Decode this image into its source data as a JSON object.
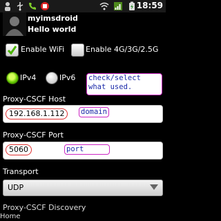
{
  "status_bar": {
    "time": "18:59",
    "icons": [
      "person-icon",
      "usb-icon",
      "call-icon",
      "stop-icon",
      "wifi-icon",
      "signal-icon",
      "battery-icon"
    ]
  },
  "header": {
    "name": "myimsdroid",
    "subtitle": "Hello world"
  },
  "checkboxes": [
    {
      "label": "Enable WiFi",
      "checked": true
    },
    {
      "label": "Enable 4G/3G/2.5G",
      "checked": false
    }
  ],
  "radios": [
    {
      "label": "IPv4",
      "selected": true
    },
    {
      "label": "IPv6",
      "selected": false
    }
  ],
  "notes": {
    "check_select": [
      "check/select",
      "what used."
    ],
    "domain": "domain",
    "port": "port"
  },
  "host": {
    "label": "Proxy-CSCF Host",
    "value": "192.168.1.112"
  },
  "port": {
    "label": "Proxy-CSCF Port",
    "value": "5060"
  },
  "transport": {
    "label": "Transport",
    "value": "UDP"
  },
  "discovery": {
    "label": "Proxy-CSCF Discovery"
  },
  "footer": {
    "home": "Home"
  },
  "colors": {
    "accent_green": "#62c700",
    "note_text": "#1b2aa9",
    "note_border": "#cc27c4",
    "field_highlight": "#e03030"
  }
}
